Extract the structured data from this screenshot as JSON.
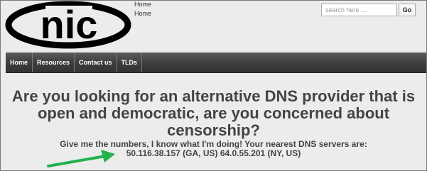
{
  "header": {
    "logo_text": "nic",
    "breadcrumbs": [
      "Home",
      "Home"
    ],
    "search": {
      "placeholder": "search here ...",
      "button_label": "Go"
    }
  },
  "nav": {
    "items": [
      {
        "label": "Home"
      },
      {
        "label": "Resources"
      },
      {
        "label": "Contact us"
      },
      {
        "label": "TLDs"
      }
    ]
  },
  "main": {
    "headline_line1": "Are you looking for an alternative DNS provider that is",
    "headline_line2": "open and democratic, are you concerned about",
    "headline_line3": "censorship?",
    "dns_intro": "Give me the numbers, I know what I'm doing! Your nearest DNS servers are:",
    "dns_servers": "50.116.38.157 (GA, US) 64.0.55.201 (NY, US)"
  },
  "colors": {
    "background": "#ececec",
    "navbar": "#3c3c3c",
    "text": "#444444",
    "arrow": "#22b14c"
  },
  "icons": {
    "arrow": "green-arrow-icon"
  }
}
